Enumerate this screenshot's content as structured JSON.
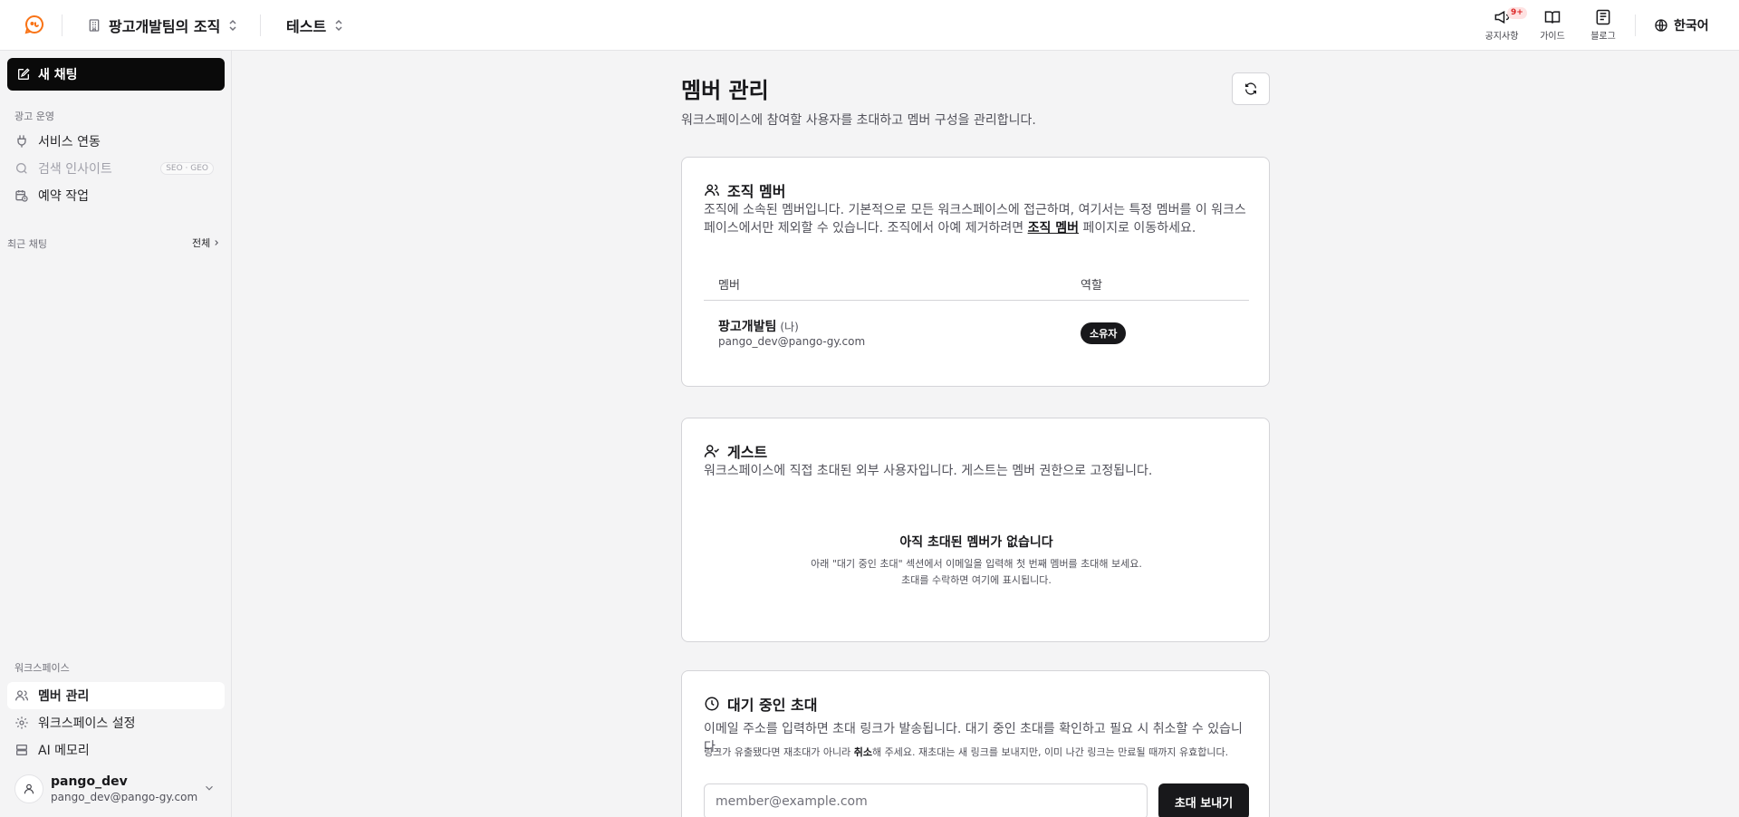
{
  "header": {
    "org_name": "팡고개발팀의 조직",
    "project_name": "테스트",
    "notice_label": "공지사항",
    "notice_badge": "9+",
    "guide_label": "가이드",
    "blog_label": "블로그",
    "language": "한국어"
  },
  "sidebar": {
    "new_chat": "새 채팅",
    "ad_ops_label": "광고 운영",
    "items": [
      {
        "label": "서비스 연동"
      },
      {
        "label": "검색 인사이트",
        "tag": "SEO · GEO"
      },
      {
        "label": "예약 작업"
      }
    ],
    "recent_label": "최근 채팅",
    "recent_all": "전체",
    "workspace_label": "워크스페이스",
    "workspace_items": [
      {
        "label": "멤버 관리"
      },
      {
        "label": "워크스페이스 설정"
      },
      {
        "label": "AI 메모리"
      }
    ],
    "user": {
      "name": "pango_dev",
      "email": "pango_dev@pango-gy.com"
    }
  },
  "page": {
    "title": "멤버 관리",
    "description": "워크스페이스에 참여할 사용자를 초대하고 멤버 구성을 관리합니다."
  },
  "org_members": {
    "title": "조직 멤버",
    "desc_before": "조직에 소속된 멤버입니다. 기본적으로 모든 워크스페이스에 접근하며, 여기서는 특정 멤버를 이 워크스페이스에서만 제외할 수 있습니다. 조직에서 아예 제거하려면 ",
    "desc_link": "조직 멤버",
    "desc_after": " 페이지로 이동하세요.",
    "columns": [
      "멤버",
      "역할"
    ],
    "rows": [
      {
        "name": "팡고개발팀",
        "me": "(나)",
        "email": "pango_dev@pango-gy.com",
        "role": "소유자"
      }
    ]
  },
  "guests": {
    "title": "게스트",
    "description": "워크스페이스에 직접 초대된 외부 사용자입니다. 게스트는 멤버 권한으로 고정됩니다.",
    "empty_title": "아직 초대된 멤버가 없습니다",
    "empty_line1": "아래 \"대기 중인 초대\" 섹션에서 이메일을 입력해 첫 번째 멤버를 초대해 보세요.",
    "empty_line2": "초대를 수락하면 여기에 표시됩니다."
  },
  "pending": {
    "title": "대기 중인 초대",
    "description": "이메일 주소를 입력하면 초대 링크가 발송됩니다. 대기 중인 초대를 확인하고 필요 시 취소할 수 있습니다.",
    "note_before": "링크가 유출됐다면 재초대가 아니라 ",
    "note_bold": "취소",
    "note_after": "해 주세요. 재초대는 새 링크를 보내지만, 이미 나간 링크는 만료될 때까지 유효합니다.",
    "input_placeholder": "member@example.com",
    "send_button": "초대 보내기"
  }
}
